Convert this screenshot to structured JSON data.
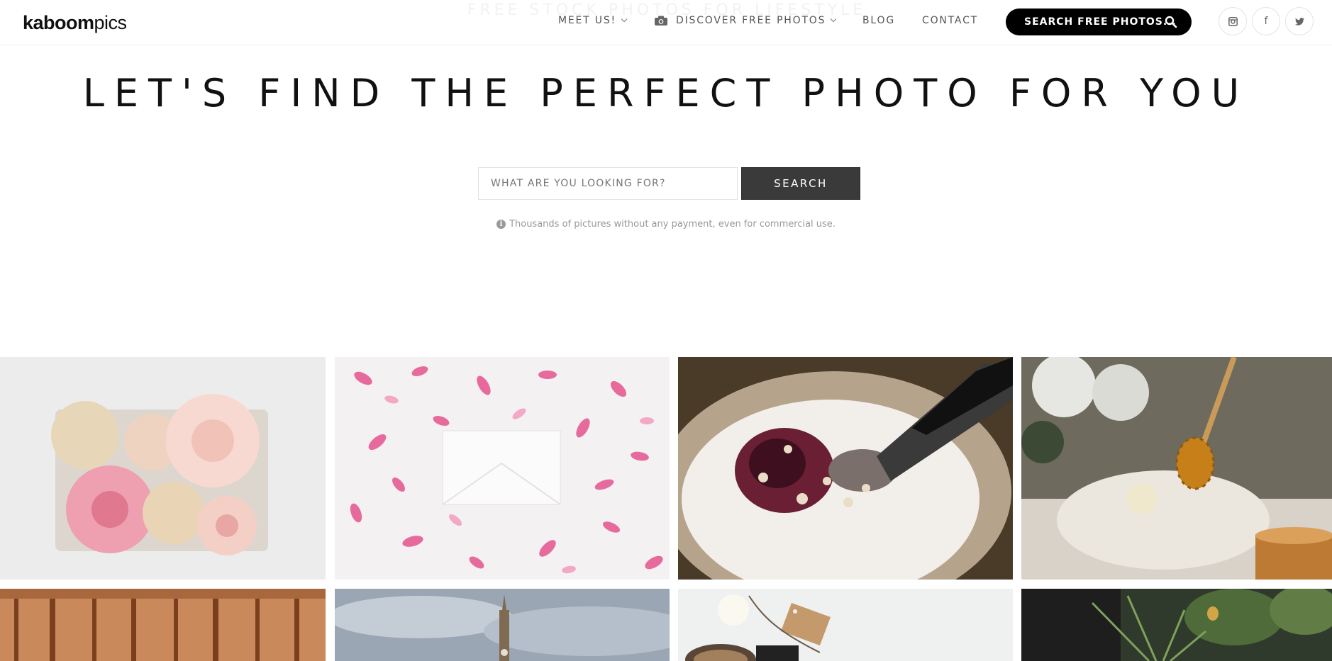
{
  "header": {
    "logo_bold": "kaboom",
    "logo_light": "pics",
    "ghost_text": "FREE STOCK PHOTOS FOR LIFESTYLE",
    "nav": {
      "meet_us": "MEET US!",
      "discover": "DISCOVER FREE PHOTOS",
      "blog": "BLOG",
      "contact": "CONTACT"
    },
    "search_pill": "SEARCH FREE PHOTOS...",
    "social": {
      "instagram": "◙",
      "facebook": "f",
      "twitter": "t"
    }
  },
  "hero": {
    "title": "LET'S FIND THE PERFECT PHOTO FOR YOU",
    "search_placeholder": "WHAT ARE YOU LOOKING FOR?",
    "search_button": "SEARCH",
    "info_text": "Thousands of pictures without any payment, even for commercial use."
  },
  "photos": [
    {
      "name": "photo-flower-box",
      "accent": "#f2c6c6"
    },
    {
      "name": "photo-pink-petals-envelope",
      "accent": "#e26a9a"
    },
    {
      "name": "photo-yogurt-jam-spoon",
      "accent": "#6b1f34"
    },
    {
      "name": "photo-honey-dipper",
      "accent": "#c88a2a"
    },
    {
      "name": "photo-rusty-wall",
      "accent": "#b06a38"
    },
    {
      "name": "photo-tower-sky",
      "accent": "#8c97a5"
    },
    {
      "name": "photo-twine-tag",
      "accent": "#c49a6c"
    },
    {
      "name": "photo-plants",
      "accent": "#3e5a33"
    }
  ]
}
